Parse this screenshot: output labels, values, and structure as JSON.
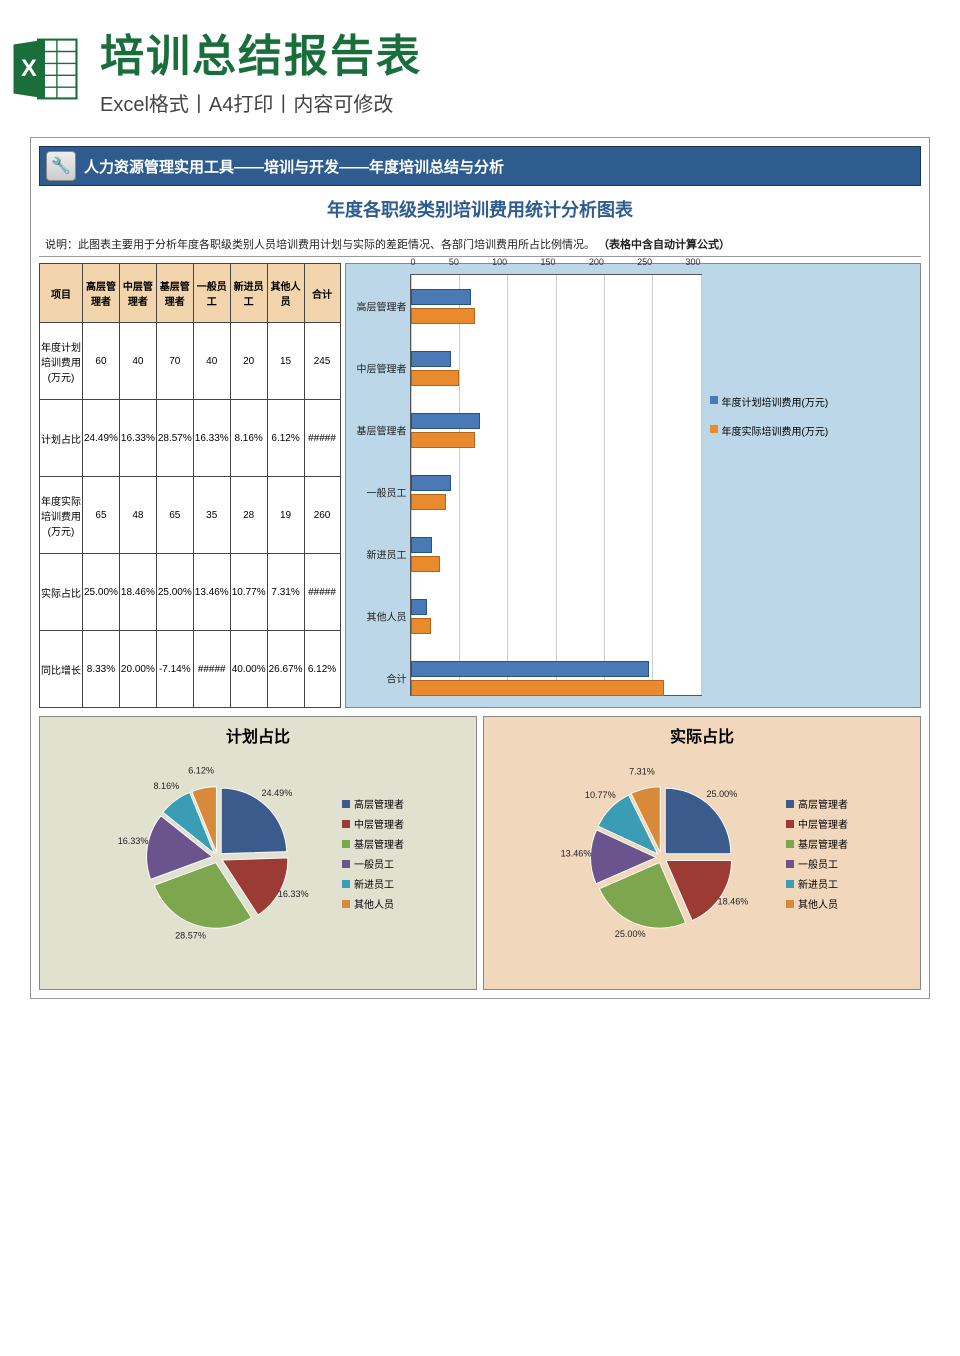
{
  "header": {
    "title": "培训总结报告表",
    "subtitle": "Excel格式丨A4打印丨内容可修改"
  },
  "doc": {
    "banner": "人力资源管理实用工具——培训与开发——年度培训总结与分析",
    "subbanner": "年度各职级类别培训费用统计分析图表",
    "desc_prefix": "说明：此图表主要用于分析年度各职级类别人员培训费用计划与实际的差距情况、各部门培训费用所占比例情况。",
    "desc_bold": "（表格中含自动计算公式）"
  },
  "table": {
    "headers": [
      "项目",
      "高层管理者",
      "中层管理者",
      "基层管理者",
      "一般员工",
      "新进员工",
      "其他人员",
      "合计"
    ],
    "rows": [
      {
        "label": "年度计划培训费用(万元)",
        "cells": [
          "60",
          "40",
          "70",
          "40",
          "20",
          "15",
          "245"
        ]
      },
      {
        "label": "计划占比",
        "cells": [
          "24.49%",
          "16.33%",
          "28.57%",
          "16.33%",
          "8.16%",
          "6.12%",
          "#####"
        ]
      },
      {
        "label": "年度实际培训费用(万元)",
        "cells": [
          "65",
          "48",
          "65",
          "35",
          "28",
          "19",
          "260"
        ]
      },
      {
        "label": "实际占比",
        "cells": [
          "25.00%",
          "18.46%",
          "25.00%",
          "13.46%",
          "10.77%",
          "7.31%",
          "#####"
        ]
      },
      {
        "label": "同比增长",
        "cells": [
          "8.33%",
          "20.00%",
          "-7.14%",
          "#####",
          "40.00%",
          "26.67%",
          "6.12%"
        ]
      }
    ]
  },
  "chart_data": [
    {
      "type": "bar",
      "orientation": "horizontal",
      "title": "",
      "xlim": [
        0,
        300
      ],
      "xticks": [
        0,
        50,
        100,
        150,
        200,
        250,
        300
      ],
      "categories": [
        "高层管理者",
        "中层管理者",
        "基层管理者",
        "一般员工",
        "新进员工",
        "其他人员",
        "合计"
      ],
      "series": [
        {
          "name": "年度计划培训费用(万元)",
          "color": "#4a7ab5",
          "values": [
            60,
            40,
            70,
            40,
            20,
            15,
            245
          ]
        },
        {
          "name": "年度实际培训费用(万元)",
          "color": "#e88b2e",
          "values": [
            65,
            48,
            65,
            35,
            28,
            19,
            260
          ]
        }
      ]
    },
    {
      "type": "pie",
      "title": "计划占比",
      "series": [
        {
          "name": "高层管理者",
          "value": 24.49,
          "color": "#3a5b8c",
          "label": "24.49%"
        },
        {
          "name": "中层管理者",
          "value": 16.33,
          "color": "#9c3b34",
          "label": "16.33%"
        },
        {
          "name": "基层管理者",
          "value": 28.57,
          "color": "#7ea64e",
          "label": "28.57%"
        },
        {
          "name": "一般员工",
          "value": 16.33,
          "color": "#6b548e",
          "label": "16.33%"
        },
        {
          "name": "新进员工",
          "value": 8.16,
          "color": "#3a9cb5",
          "label": "8.16%"
        },
        {
          "name": "其他人员",
          "value": 6.12,
          "color": "#d88a3a",
          "label": "6.12%"
        }
      ]
    },
    {
      "type": "pie",
      "title": "实际占比",
      "series": [
        {
          "name": "高层管理者",
          "value": 25.0,
          "color": "#3a5b8c",
          "label": "25.00%"
        },
        {
          "name": "中层管理者",
          "value": 18.46,
          "color": "#9c3b34",
          "label": "18.46%"
        },
        {
          "name": "基层管理者",
          "value": 25.0,
          "color": "#7ea64e",
          "label": "25.00%"
        },
        {
          "name": "一般员工",
          "value": 13.46,
          "color": "#6b548e",
          "label": "13.46%"
        },
        {
          "name": "新进员工",
          "value": 10.77,
          "color": "#3a9cb5",
          "label": "10.77%"
        },
        {
          "name": "其他人员",
          "value": 7.31,
          "color": "#d88a3a",
          "label": "7.31%"
        }
      ]
    }
  ],
  "pie_legend": [
    "高层管理者",
    "中层管理者",
    "基层管理者",
    "一般员工",
    "新进员工",
    "其他人员"
  ],
  "pie_colors": [
    "#3a5b8c",
    "#9c3b34",
    "#7ea64e",
    "#6b548e",
    "#3a9cb5",
    "#d88a3a"
  ]
}
